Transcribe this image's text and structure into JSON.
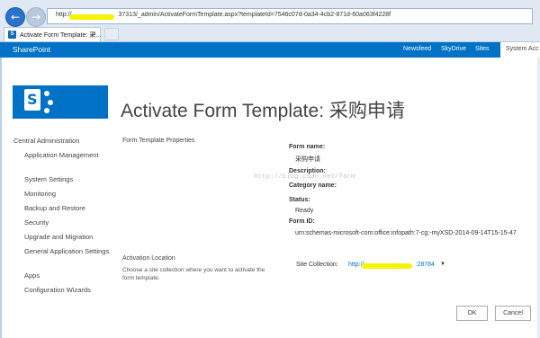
{
  "browser": {
    "url_prefix": "http://",
    "url_rest": "37313/_admin/ActivateFormTemplate.aspx?templateId=7546c07d-0a34-4cb2-871d-60a063f4228f",
    "tab_title": "Activate Form Template: 采...",
    "tab_close": "×",
    "back_icon": "←",
    "forward_icon": "→",
    "sp_glyph": "S"
  },
  "suite": {
    "brand": "SharePoint",
    "links": [
      "Newsfeed",
      "SkyDrive",
      "Sites"
    ],
    "system_account": "System Acc"
  },
  "page": {
    "title": "Activate Form Template: 采购申请",
    "logo_letter": "S"
  },
  "quick_launch": {
    "heading": "Central Administration",
    "items": [
      "Application Management",
      "System Settings",
      "Monitoring",
      "Backup and Restore",
      "Security",
      "Upgrade and Migration",
      "General Application Settings",
      "Apps",
      "Configuration Wizards"
    ]
  },
  "properties": {
    "section_label": "Form Template Properties",
    "form_name_label": "Form name:",
    "form_name": "采购申请",
    "description_label": "Description:",
    "category_label": "Category name:",
    "status_label": "Status:",
    "status": "Ready",
    "form_id_label": "Form ID:",
    "form_id": "urn:schemas-microsoft-com:office:infopath:7-cg:-myXSD-2014-09-14T15-15-47"
  },
  "activation": {
    "section_label": "Activation Location",
    "description": "Choose a site collection where you want to activate the form template.",
    "site_collection_label": "Site Collection:",
    "site_collection_value": "http://",
    "site_collection_port": ":28784",
    "chevron": "▼"
  },
  "buttons": {
    "ok": "OK",
    "cancel": "Cancel"
  },
  "watermark": "http://blog.csdn.net/farm",
  "colors": {
    "brand_blue": "#0072c6",
    "highlight": "#f6f200"
  }
}
